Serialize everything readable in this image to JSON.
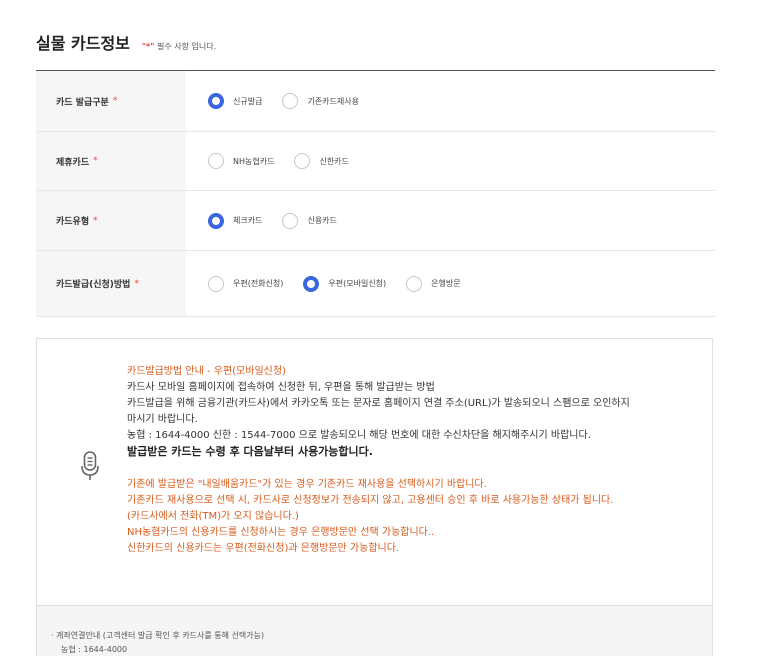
{
  "section": {
    "title": "실물 카드정보",
    "required_note_prefix": "\"*\"",
    "required_note_text": "필수 사항 입니다."
  },
  "form": {
    "rows": [
      {
        "label": "카드 발급구분",
        "star": "*",
        "options": [
          {
            "label": "신규발급",
            "checked": true
          },
          {
            "label": "기존카드재사용",
            "checked": false
          }
        ]
      },
      {
        "label": "제휴카드",
        "star": "*",
        "options": [
          {
            "label": "NH농협카드",
            "checked": false
          },
          {
            "label": "신한카드",
            "checked": false
          }
        ]
      },
      {
        "label": "카드유형",
        "star": "*",
        "options": [
          {
            "label": "체크카드",
            "checked": true
          },
          {
            "label": "신용카드",
            "checked": false
          }
        ]
      },
      {
        "label": "카드발급(신청)방법",
        "star": "*",
        "options": [
          {
            "label": "우편(전화신청)",
            "checked": false
          },
          {
            "label": "우편(모바일신청)",
            "checked": true
          },
          {
            "label": "은행방문",
            "checked": false
          }
        ]
      }
    ]
  },
  "notice": {
    "icon": "microphone-icon",
    "heading": "카드발급방법 안내 - 우편(모바일신청)",
    "line1": "카드사 모바일 홈페이지에 접속하여 신청한 뒤, 우편을 통해 발급받는 방법",
    "line2": "카드발급을 위해 금융기관(카드사)에서 카카오톡 또는 문자로 홈페이지 연결 주소(URL)가 발송되오니 스팸으로 오인하지",
    "line3": "마시기 바랍니다.",
    "line4": "농협 : 1644-4000 신한 : 1544-7000 으로 발송되오니 해당 번호에 대한 수신차단을 해지해주시기 바랍니다.",
    "bold_line": "발급받은 카드는 수령 후 다음날부터 사용가능합니다.",
    "orange1": "기존에 발급받은 \"내일배움카드\"가 있는 경우 기존카드 재사용을 선택하시기 바랍니다.",
    "orange2": "기존카드 재사용으로 선택 시, 카드사로 신청정보가 전송되지 않고, 고용센터 승인 후 바로 사용가능한 상태가 됩니다.",
    "orange3": "(카드사에서 전화(TM)가 오지 않습니다.)",
    "orange4": "NH농협카드의 신용카드를 신청하시는 경우 은행방문만 선택 가능합니다..",
    "orange5": "신한카드의 신용카드는 우편(전화신청)과 은행방문만 가능합니다."
  },
  "footer": {
    "line1": "· 계좌연결안내 (고객센터 발급 확인 후 카드사를 통해 선택가능)",
    "line2": "농협 : 1644-4000"
  },
  "colors": {
    "accent": "#3a66de",
    "required_star": "#e8413c",
    "notice_orange": "#d95b1c"
  }
}
